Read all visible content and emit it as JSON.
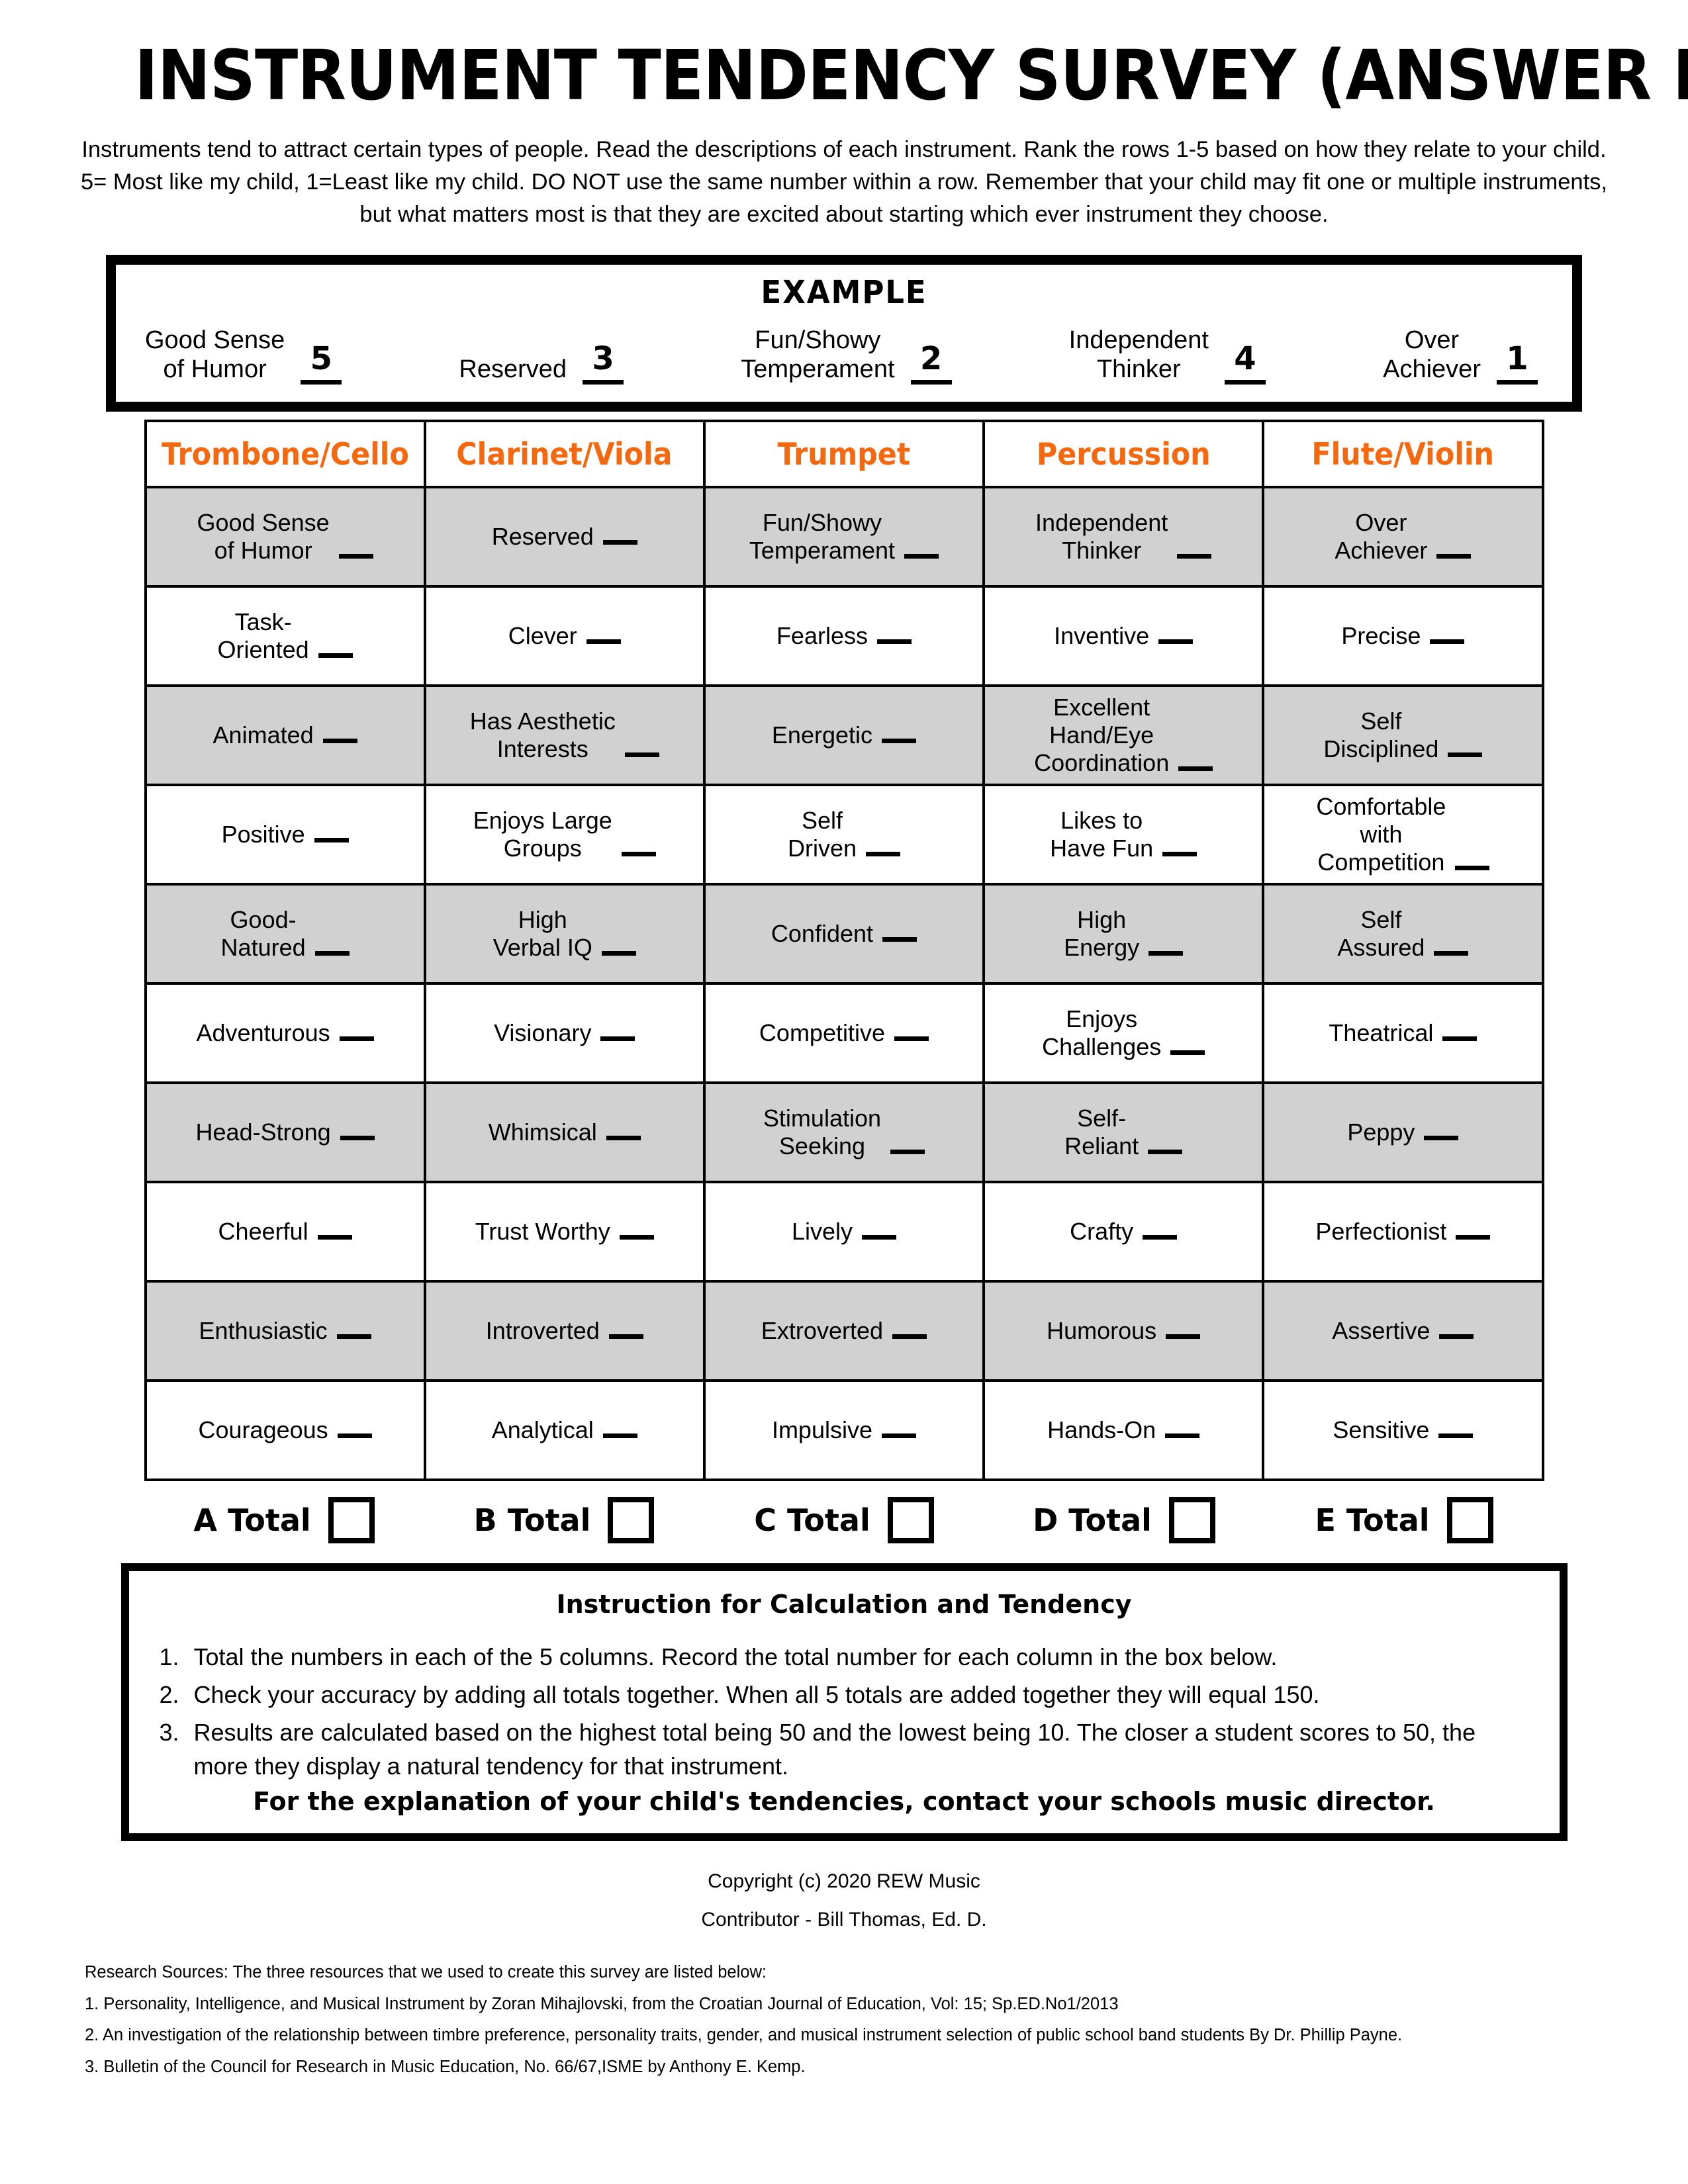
{
  "document": {
    "title": "INSTRUMENT TENDENCY SURVEY (ANSWER KEY)",
    "intro": "Instruments tend to attract certain types of people. Read the descriptions of each instrument. Rank the rows 1-5 based on how they relate to your child. 5= Most like my child, 1=Least like my child. DO NOT use the same number within a row. Remember that your child may fit one or multiple instruments, but what matters most is that they are excited about starting which ever instrument they choose."
  },
  "example": {
    "heading": "EXAMPLE",
    "items": [
      {
        "label": "Good Sense\nof Humor",
        "value": "5"
      },
      {
        "label": "Reserved",
        "value": "3"
      },
      {
        "label": "Fun/Showy\nTemperament",
        "value": "2"
      },
      {
        "label": "Independent\nThinker",
        "value": "4"
      },
      {
        "label": "Over\nAchiever",
        "value": "1"
      }
    ]
  },
  "survey": {
    "accent_color": "#F4690F",
    "shaded_row_color": "#D1D1D1",
    "columns": [
      "Trombone/Cello",
      "Clarinet/Viola",
      "Trumpet",
      "Percussion",
      "Flute/Violin"
    ],
    "rows": [
      {
        "shaded": true,
        "cells": [
          "Good Sense\nof Humor",
          "Reserved",
          "Fun/Showy\nTemperament",
          "Independent\nThinker",
          "Over\nAchiever"
        ]
      },
      {
        "shaded": false,
        "cells": [
          "Task-\nOriented",
          "Clever",
          "Fearless",
          "Inventive",
          "Precise"
        ]
      },
      {
        "shaded": true,
        "cells": [
          "Animated",
          "Has Aesthetic\nInterests",
          "Energetic",
          "Excellent\nHand/Eye\nCoordination",
          "Self\nDisciplined"
        ]
      },
      {
        "shaded": false,
        "cells": [
          "Positive",
          "Enjoys Large\nGroups",
          "Self\nDriven",
          "Likes to\nHave Fun",
          "Comfortable\nwith\nCompetition"
        ]
      },
      {
        "shaded": true,
        "cells": [
          "Good-\nNatured",
          "High\nVerbal IQ",
          "Confident",
          "High\nEnergy",
          "Self\nAssured"
        ]
      },
      {
        "shaded": false,
        "cells": [
          "Adventurous",
          "Visionary",
          "Competitive",
          "Enjoys\nChallenges",
          "Theatrical"
        ]
      },
      {
        "shaded": true,
        "cells": [
          "Head-Strong",
          "Whimsical",
          "Stimulation\nSeeking",
          "Self-\nReliant",
          "Peppy"
        ]
      },
      {
        "shaded": false,
        "cells": [
          "Cheerful",
          "Trust Worthy",
          "Lively",
          "Crafty",
          "Perfectionist"
        ]
      },
      {
        "shaded": true,
        "cells": [
          "Enthusiastic",
          "Introverted",
          "Extroverted",
          "Humorous",
          "Assertive"
        ]
      },
      {
        "shaded": false,
        "cells": [
          "Courageous",
          "Analytical",
          "Impulsive",
          "Hands-On",
          "Sensitive"
        ]
      }
    ],
    "totals": [
      "A Total",
      "B Total",
      "C Total",
      "D Total",
      "E Total"
    ]
  },
  "instructions": {
    "title": "Instruction for Calculation and Tendency",
    "items": [
      {
        "num": "1.",
        "text": "Total the numbers in each of the 5 columns. Record the total number for each column in the box below."
      },
      {
        "num": "2.",
        "text": "Check your accuracy by adding all totals together. When all 5 totals are added together they will equal 150."
      },
      {
        "num": "3.",
        "text": "Results are calculated based on the highest total being 50 and the lowest being 10. The closer a student scores to 50, the more they display a natural tendency for that instrument."
      }
    ],
    "closing": "For the explanation of your child's tendencies, contact your schools music director."
  },
  "footer": {
    "copyright": "Copyright (c) 2020 REW Music",
    "contributor": "Contributor - Bill Thomas, Ed. D.",
    "sources_heading": "Research Sources: The three resources that we used to create this survey are listed below:",
    "sources": [
      "1. Personality, Intelligence, and Musical Instrument by Zoran Mihajlovski, from the Croatian Journal of Education, Vol: 15; Sp.ED.No1/2013",
      "2. An investigation of the relationship between timbre preference, personality traits, gender, and musical instrument selection of public school band students By Dr. Phillip Payne.",
      "3. Bulletin of the Council for Research in Music Education, No. 66/67,ISME by Anthony E. Kemp."
    ]
  }
}
